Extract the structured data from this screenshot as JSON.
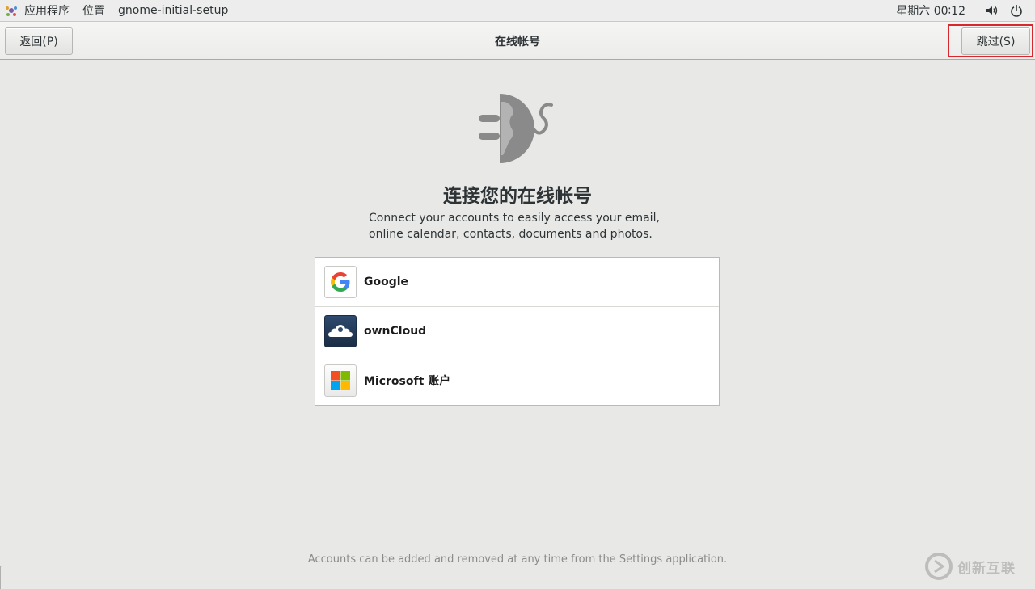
{
  "top_panel": {
    "apps_label": "应用程序",
    "places_label": "位置",
    "app_name": "gnome-initial-setup",
    "clock": "星期六 00∶12",
    "icons": [
      "volume-icon",
      "power-icon"
    ]
  },
  "header": {
    "back_label": "返回(P)",
    "title": "在线帐号",
    "skip_label": "跳过(S)"
  },
  "main": {
    "title": "连接您的在线帐号",
    "description_line1": "Connect your accounts to easily access your email,",
    "description_line2": "online calendar, contacts, documents and photos.",
    "accounts": [
      {
        "label": "Google",
        "icon": "google-icon"
      },
      {
        "label": "ownCloud",
        "icon": "owncloud-icon"
      },
      {
        "label": "Microsoft 账户",
        "icon": "microsoft-icon"
      }
    ],
    "footer": "Accounts can be added and removed at any time from the Settings application."
  },
  "watermark": {
    "text": "创新互联"
  },
  "colors": {
    "highlight_border": "#d9272e",
    "background": "#e8e8e7"
  }
}
